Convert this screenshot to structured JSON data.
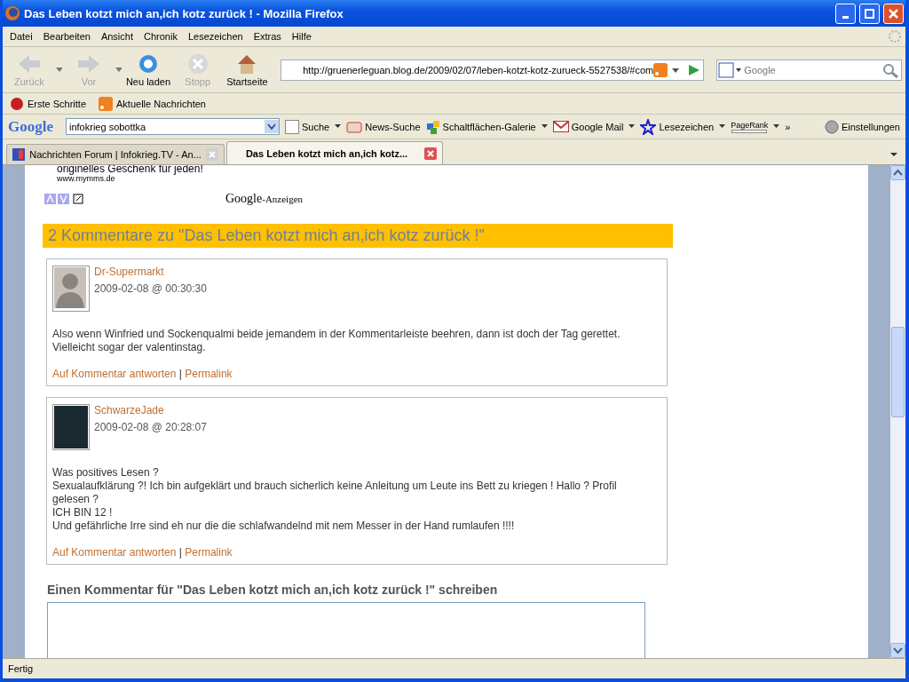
{
  "window": {
    "title": "Das Leben kotzt mich an,ich kotz zurück ! - Mozilla Firefox"
  },
  "menu": [
    "Datei",
    "Bearbeiten",
    "Ansicht",
    "Chronik",
    "Lesezeichen",
    "Extras",
    "Hilfe"
  ],
  "nav_buttons": [
    {
      "kind": "back",
      "label": "Zurück",
      "disabled": true
    },
    {
      "kind": "forward",
      "label": "Vor",
      "disabled": true
    },
    {
      "kind": "reload",
      "label": "Neu laden",
      "disabled": false
    },
    {
      "kind": "stop",
      "label": "Stopp",
      "disabled": true
    },
    {
      "kind": "home",
      "label": "Startseite",
      "disabled": false
    }
  ],
  "address": {
    "value": "http://gruenerleguan.blog.de/2009/02/07/leben-kotzt-kotz-zurueck-5527538/#com"
  },
  "search": {
    "placeholder": "Google"
  },
  "bookmarks": [
    {
      "kind": "start",
      "label": "Erste Schritte"
    },
    {
      "kind": "rss",
      "label": "Aktuelle Nachrichten"
    }
  ],
  "google_toolbar": {
    "logo": "Google",
    "query": "infokrieg sobottka",
    "items": [
      {
        "kind": "search",
        "label": "Suche"
      },
      {
        "kind": "news",
        "label": "News-Suche"
      },
      {
        "kind": "gallery",
        "label": "Schaltflächen-Galerie"
      },
      {
        "kind": "mail",
        "label": "Google Mail"
      },
      {
        "kind": "star",
        "label": "Lesezeichen"
      },
      {
        "kind": "pagerank",
        "label": "PageRank"
      },
      {
        "kind": "more",
        "label": "»"
      }
    ],
    "settings": "Einstellungen"
  },
  "tabs": [
    {
      "title": "Nachrichten Forum | Infokrieg.TV - An...",
      "selected": false
    },
    {
      "title": "Das Leben kotzt mich an,ich kotz...",
      "selected": true
    }
  ],
  "ad": {
    "text": "originelles Geschenk für jeden!",
    "url": "www.mymms.de",
    "google_logo": "Google",
    "google_label": "-Anzeigen"
  },
  "comments_heading": "2 Kommentare zu \"Das Leben kotzt mich an,ich kotz zurück !\"",
  "comments": [
    {
      "kind": "silhouette",
      "author": "Dr-Supermarkt",
      "date": "2009-02-08 @ 00:30:30",
      "lines": [
        "Also wenn Winfried und Sockenqualmi beide jemandem in der Kommentarleiste beehren, dann ist doch der Tag gerettet.",
        "Vielleicht sogar der valentinstag."
      ],
      "reply": "Auf Kommentar antworten",
      "separator": "|",
      "permalink": "Permalink"
    },
    {
      "kind": "photo",
      "author": "SchwarzeJade",
      "date": "2009-02-08 @ 20:28:07",
      "lines": [
        "Was positives Lesen ?",
        "Sexualaufklärung ?! Ich bin aufgeklärt und brauch sicherlich keine Anleitung um Leute ins Bett zu kriegen ! Hallo ? Profil gelesen ?",
        "ICH BIN 12 !",
        "Und gefährliche Irre sind eh nur die die schlafwandelnd mit nem Messer in der Hand rumlaufen !!!!"
      ],
      "reply": "Auf Kommentar antworten",
      "separator": "|",
      "permalink": "Permalink"
    }
  ],
  "form_heading": "Einen Kommentar für \"Das Leben kotzt mich an,ich kotz zurück !\" schreiben",
  "status_bar": "Fertig"
}
